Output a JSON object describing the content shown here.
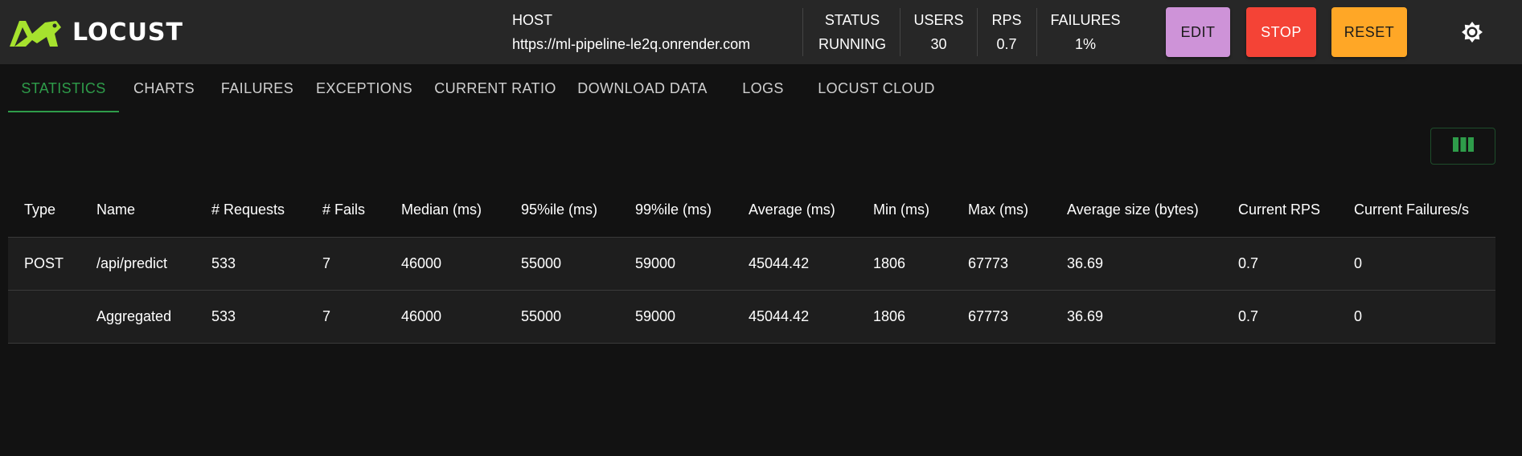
{
  "header": {
    "logo_text": "LOCUST",
    "host": {
      "label": "HOST",
      "value": "https://ml-pipeline-le2q.onrender.com"
    },
    "status": {
      "label": "STATUS",
      "value": "RUNNING"
    },
    "users": {
      "label": "USERS",
      "value": "30"
    },
    "rps": {
      "label": "RPS",
      "value": "0.7"
    },
    "failures": {
      "label": "FAILURES",
      "value": "1%"
    },
    "buttons": {
      "edit": "EDIT",
      "stop": "STOP",
      "reset": "RESET"
    },
    "theme_icon": "brightness-icon"
  },
  "tabs": [
    {
      "label": "STATISTICS",
      "active": true
    },
    {
      "label": "CHARTS"
    },
    {
      "label": "FAILURES"
    },
    {
      "label": "EXCEPTIONS"
    },
    {
      "label": "CURRENT RATIO"
    },
    {
      "label": "DOWNLOAD DATA"
    },
    {
      "label": "LOGS"
    },
    {
      "label": "LOCUST CLOUD"
    }
  ],
  "column_selector_icon": "view-column-icon",
  "table": {
    "columns": [
      "Type",
      "Name",
      "# Requests",
      "# Fails",
      "Median (ms)",
      "95%ile (ms)",
      "99%ile (ms)",
      "Average (ms)",
      "Min (ms)",
      "Max (ms)",
      "Average size (bytes)",
      "Current RPS",
      "Current Failures/s"
    ],
    "rows": [
      [
        "POST",
        "/api/predict",
        "533",
        "7",
        "46000",
        "55000",
        "59000",
        "45044.42",
        "1806",
        "67773",
        "36.69",
        "0.7",
        "0"
      ],
      [
        "",
        "Aggregated",
        "533",
        "7",
        "46000",
        "55000",
        "59000",
        "45044.42",
        "1806",
        "67773",
        "36.69",
        "0.7",
        "0"
      ]
    ]
  },
  "colors": {
    "accent_green": "#2e9c4a",
    "logo_green": "#a6e22e",
    "edit": "#ce93d8",
    "stop": "#f44336",
    "reset": "#ffa726"
  }
}
